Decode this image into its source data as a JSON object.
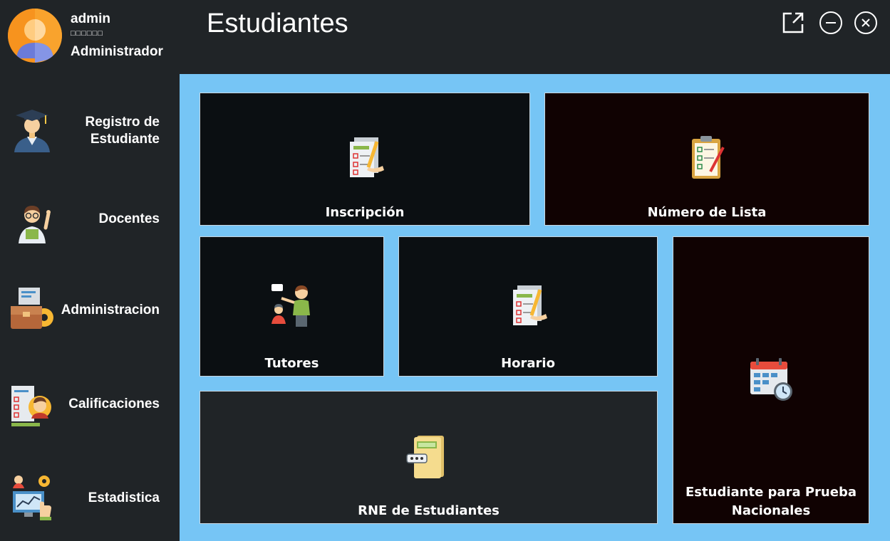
{
  "profile": {
    "username": "admin",
    "status": "□□□□□□",
    "role": "Administrador"
  },
  "sidebar": {
    "items": [
      {
        "label_line1": "Registro de",
        "label_line2": "Estudiante",
        "icon": "graduate-icon"
      },
      {
        "label": "Docentes",
        "icon": "teacher-icon"
      },
      {
        "label": "Administracion",
        "icon": "briefcase-gear-icon"
      },
      {
        "label": "Calificaciones",
        "icon": "grades-icon"
      },
      {
        "label": "Estadistica",
        "icon": "statistics-icon"
      }
    ]
  },
  "header": {
    "title": "Estudiantes",
    "buttons": [
      "external-link-icon",
      "minimize-icon",
      "close-icon"
    ]
  },
  "tiles": [
    {
      "label": "Inscripción",
      "icon": "checklist-pen-icon"
    },
    {
      "label": "Número de Lista",
      "icon": "clipboard-icon"
    },
    {
      "label": "Tutores",
      "icon": "tutor-icon"
    },
    {
      "label": "Horario",
      "icon": "checklist-pen-icon"
    },
    {
      "label_line1": "Estudiante para Prueba",
      "label_line2": "Nacionales",
      "icon": "calendar-clock-icon"
    },
    {
      "label": "RNE de Estudiantes",
      "icon": "folder-id-icon"
    }
  ],
  "colors": {
    "sidebar_bg": "#202427",
    "main_bg": "#76c5f5",
    "tile_dark": "#0b0f12",
    "tile_maroon": "#100202",
    "tile_gray": "#202427",
    "avatar_orange": "#f7931e"
  }
}
